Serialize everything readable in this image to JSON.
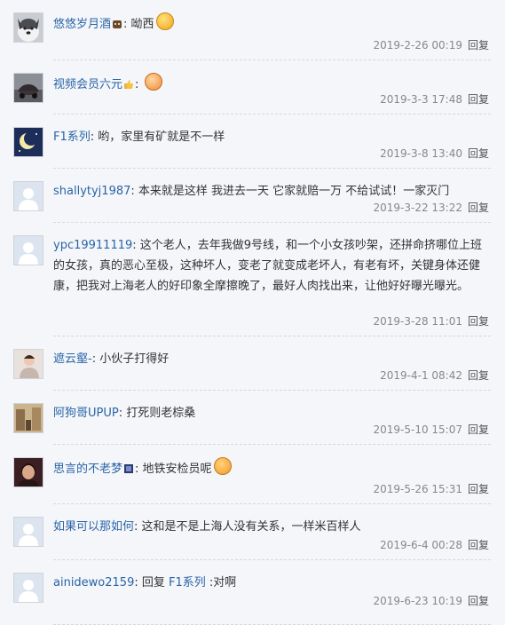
{
  "comments": [
    {
      "user": "悠悠岁月酒",
      "text": "呦西",
      "time": "2019-2-26 00:19",
      "reply": "回复"
    },
    {
      "user": "视频会员六元",
      "text": "",
      "time": "2019-3-3 17:48",
      "reply": "回复"
    },
    {
      "user": "F1系列",
      "text": "哟，家里有矿就是不一样",
      "time": "2019-3-8 13:40",
      "reply": "回复"
    },
    {
      "user": "shallytyj1987",
      "text": "本来就是这样 我进去一天 它家就赔一万 不给试试！一家灭门",
      "time": "2019-3-22 13:22",
      "reply": "回复"
    },
    {
      "user": "ypc19911119",
      "text": "这个老人，去年我做9号线，和一个小女孩吵架，还拼命挤哪位上班的女孩，真的恶心至极，这种坏人，变老了就变成老坏人，有老有坏，关键身体还健康，把我对上海老人的好印象全摩擦晚了，最好人肉找出来，让他好好曝光曝光。",
      "time": "2019-3-28 11:01",
      "reply": "回复"
    },
    {
      "user": "遮云壑-",
      "text": "小伙子打得好",
      "time": "2019-4-1 08:42",
      "reply": "回复"
    },
    {
      "user": "阿狗哥UPUP",
      "text": "打死则老棕桑",
      "time": "2019-5-10 15:07",
      "reply": "回复"
    },
    {
      "user": "思言的不老梦",
      "text": "地铁安检员呢",
      "time": "2019-5-26 15:31",
      "reply": "回复"
    },
    {
      "user": "如果可以那如何",
      "text": "这和是不是上海人没有关系，一样米百样人",
      "time": "2019-6-4 00:28",
      "reply": "回复"
    },
    {
      "user": "ainidewo2159",
      "reply_word": "回复",
      "reply_to": "F1系列",
      "text": ":对啊",
      "time": "2019-6-23 10:19",
      "reply": "回复"
    }
  ],
  "colors": {
    "link": "#2a64a8",
    "background": "#f4f6f9",
    "meta": "#888888"
  }
}
